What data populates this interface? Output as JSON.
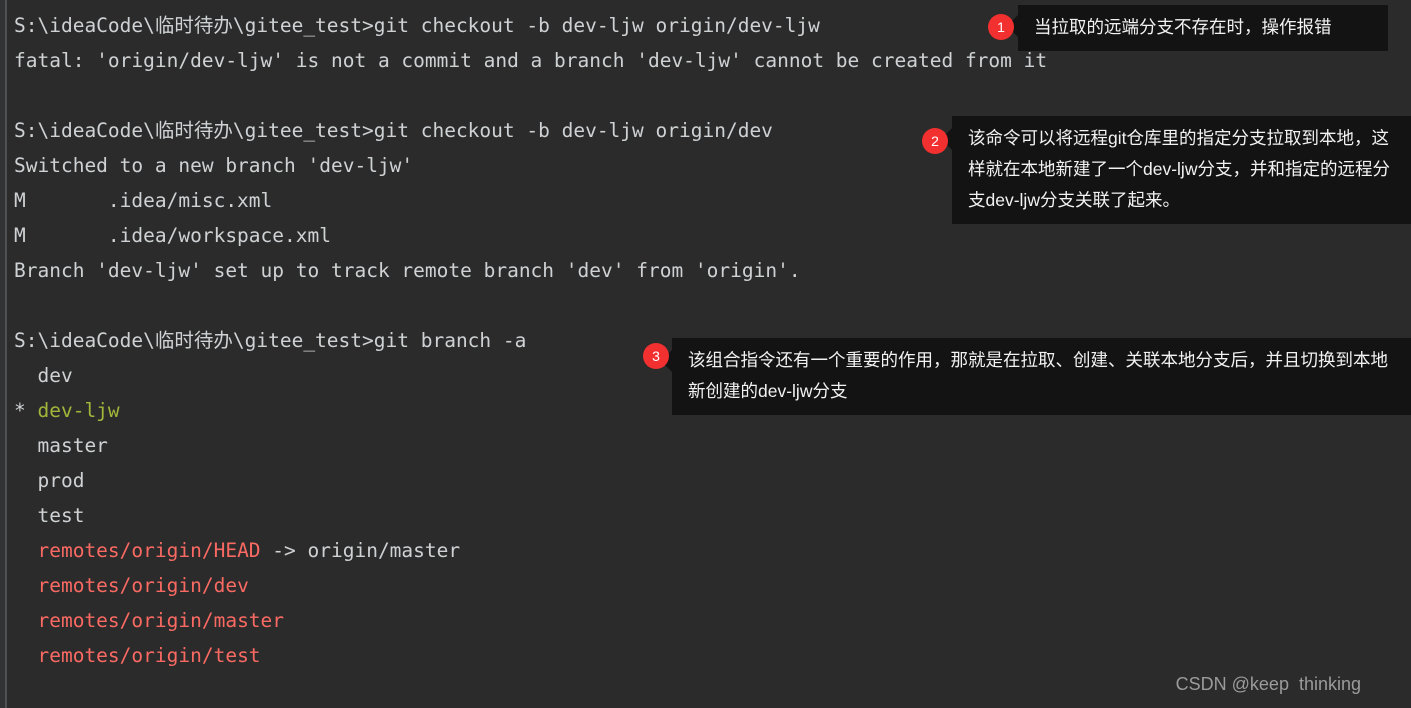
{
  "terminal": {
    "background_color": "#2b2b2b",
    "default_text_color": "#cfd2d4",
    "lines": [
      {
        "segments": [
          {
            "text": "S:\\ideaCode\\临时待办\\gitee_test>git checkout -b dev-ljw origin/dev-ljw",
            "color": "default"
          }
        ]
      },
      {
        "segments": [
          {
            "text": "fatal: 'origin/dev-ljw' is not a commit and a branch 'dev-ljw' cannot be created from it",
            "color": "default"
          }
        ]
      },
      {
        "segments": [
          {
            "text": "",
            "color": "default"
          }
        ]
      },
      {
        "segments": [
          {
            "text": "S:\\ideaCode\\临时待办\\gitee_test>git checkout -b dev-ljw origin/dev",
            "color": "default"
          }
        ]
      },
      {
        "segments": [
          {
            "text": "Switched to a new branch 'dev-ljw'",
            "color": "default"
          }
        ]
      },
      {
        "segments": [
          {
            "text": "M       .idea/misc.xml",
            "color": "default"
          }
        ]
      },
      {
        "segments": [
          {
            "text": "M       .idea/workspace.xml",
            "color": "default"
          }
        ]
      },
      {
        "segments": [
          {
            "text": "Branch 'dev-ljw' set up to track remote branch 'dev' from 'origin'.",
            "color": "default"
          }
        ]
      },
      {
        "segments": [
          {
            "text": "",
            "color": "default"
          }
        ]
      },
      {
        "segments": [
          {
            "text": "S:\\ideaCode\\临时待办\\gitee_test>git branch -a",
            "color": "default"
          }
        ]
      },
      {
        "segments": [
          {
            "text": "  dev",
            "color": "default"
          }
        ]
      },
      {
        "segments": [
          {
            "text": "* ",
            "color": "default"
          },
          {
            "text": "dev-ljw",
            "color": "green"
          }
        ]
      },
      {
        "segments": [
          {
            "text": "  master",
            "color": "default"
          }
        ]
      },
      {
        "segments": [
          {
            "text": "  prod",
            "color": "default"
          }
        ]
      },
      {
        "segments": [
          {
            "text": "  test",
            "color": "default"
          }
        ]
      },
      {
        "segments": [
          {
            "text": "  ",
            "color": "default"
          },
          {
            "text": "remotes/origin/HEAD",
            "color": "red"
          },
          {
            "text": " -> origin/master",
            "color": "default"
          }
        ]
      },
      {
        "segments": [
          {
            "text": "  ",
            "color": "default"
          },
          {
            "text": "remotes/origin/dev",
            "color": "red"
          }
        ]
      },
      {
        "segments": [
          {
            "text": "  ",
            "color": "default"
          },
          {
            "text": "remotes/origin/master",
            "color": "red"
          }
        ]
      },
      {
        "segments": [
          {
            "text": "  ",
            "color": "default"
          },
          {
            "text": "remotes/origin/test",
            "color": "red"
          }
        ]
      }
    ]
  },
  "annotations": [
    {
      "number": "1",
      "badge_color": "#f23030",
      "text": "当拉取的远端分支不存在时，操作报错"
    },
    {
      "number": "2",
      "badge_color": "#f23030",
      "text": "该命令可以将远程git仓库里的指定分支拉取到本地，这样就在本地新建了一个dev-ljw分支，并和指定的远程分支dev-ljw分支关联了起来。"
    },
    {
      "number": "3",
      "badge_color": "#f23030",
      "text": "该组合指令还有一个重要的作用，那就是在拉取、创建、关联本地分支后，并且切换到本地新创建的dev-ljw分支"
    }
  ],
  "watermark": {
    "text": "CSDN @keep  thinking",
    "color": "#9b9b9b"
  }
}
